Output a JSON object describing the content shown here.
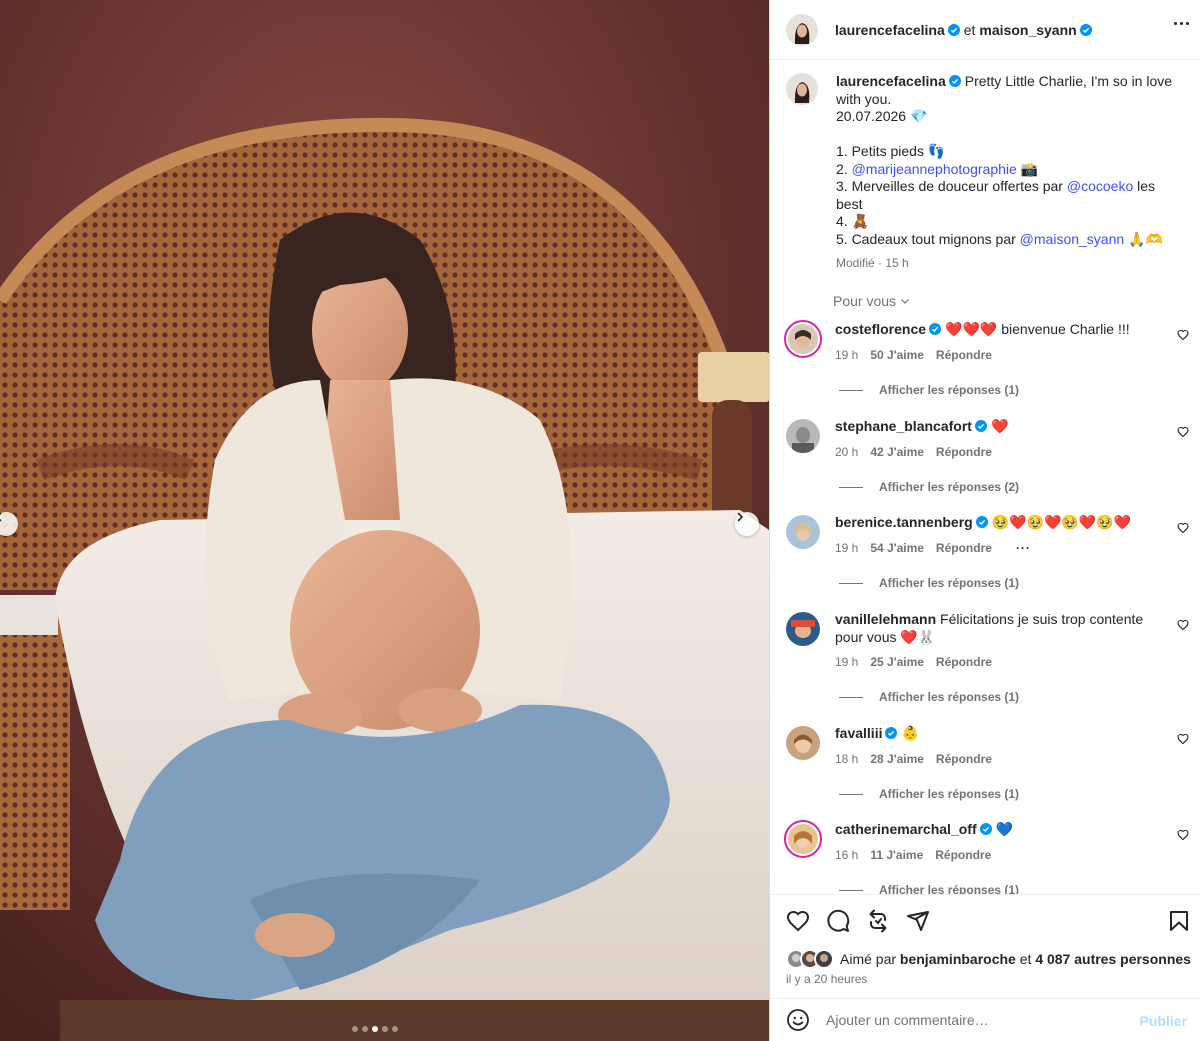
{
  "header": {
    "author": "laurencefacelina",
    "connector": "et",
    "collaborator": "maison_syann"
  },
  "caption": {
    "username": "laurencefacelina",
    "lines": [
      "Pretty Little Charlie, I'm so in love with you.",
      "20.07.2026 💎",
      "",
      "1. Petits pieds 👣",
      "2. @marijeannephotographie 📸",
      "3. Merveilles de douceur offertes par @cocoeko les best",
      "4. 🧸",
      "5. Cadeaux tout mignons par @maison_syann 🙏🫶"
    ],
    "line1": "Pretty Little Charlie, I'm so in love with you.",
    "line2": "20.07.2026 💎",
    "item1": "1. Petits pieds 👣",
    "item2_prefix": "2. ",
    "item2_mention": "@marijeannephotographie",
    "item2_suffix": " 📸",
    "item3_prefix": "3. Merveilles de douceur offertes par ",
    "item3_mention": "@cocoeko",
    "item3_suffix": " les best",
    "item4": "4. 🧸",
    "item5_prefix": "5. Cadeaux tout mignons par ",
    "item5_mention": "@maison_syann",
    "item5_suffix": " 🙏🫶",
    "meta": "Modifié · 15 h"
  },
  "filter": {
    "label": "Pour vous"
  },
  "comments": [
    {
      "username": "costeflorence",
      "verified": true,
      "text": "❤️❤️❤️ bienvenue Charlie !!!",
      "time": "19 h",
      "likes": "50 J'aime",
      "reply": "Répondre",
      "replies": "Afficher les réponses (1)"
    },
    {
      "username": "stephane_blancafort",
      "verified": true,
      "text": "❤️",
      "time": "20 h",
      "likes": "42 J'aime",
      "reply": "Répondre",
      "replies": "Afficher les réponses (2)"
    },
    {
      "username": "berenice.tannenberg",
      "verified": true,
      "text": "🥹❤️🥹❤️🥹❤️🥹❤️",
      "time": "19 h",
      "likes": "54 J'aime",
      "reply": "Répondre",
      "more": "···",
      "replies": "Afficher les réponses (1)"
    },
    {
      "username": "vanillelehmann",
      "verified": false,
      "text": "Félicitations je suis trop contente pour vous ❤️🐰",
      "time": "19 h",
      "likes": "25 J'aime",
      "reply": "Répondre",
      "replies": "Afficher les réponses (1)"
    },
    {
      "username": "favalliii",
      "verified": true,
      "text": "👶",
      "time": "18 h",
      "likes": "28 J'aime",
      "reply": "Répondre",
      "replies": "Afficher les réponses (1)"
    },
    {
      "username": "catherinemarchal_off",
      "verified": true,
      "text": "💙",
      "time": "16 h",
      "likes": "11 J'aime",
      "reply": "Répondre",
      "replies": "Afficher les réponses (1)"
    }
  ],
  "likes": {
    "prefix": "Aimé par",
    "user": "benjaminbaroche",
    "connector": "et",
    "others": "4 087 autres personnes"
  },
  "timestamp": "il y a 20 heures",
  "add_comment": {
    "placeholder": "Ajouter un commentaire…",
    "publish": "Publier"
  },
  "carousel": {
    "slides": 5,
    "active_slide": 3
  },
  "colors": {
    "verified": "#0095f6",
    "mention": "#4150f7",
    "publish_disabled": "#b2dffc",
    "heart_red": "#e0245e"
  },
  "icons": [
    "more-icon",
    "verified-icon",
    "chevron-down-icon",
    "heart-icon",
    "comment-icon",
    "repost-icon",
    "share-icon",
    "bookmark-icon",
    "emoji-icon",
    "chevron-left-icon",
    "chevron-right-icon"
  ]
}
